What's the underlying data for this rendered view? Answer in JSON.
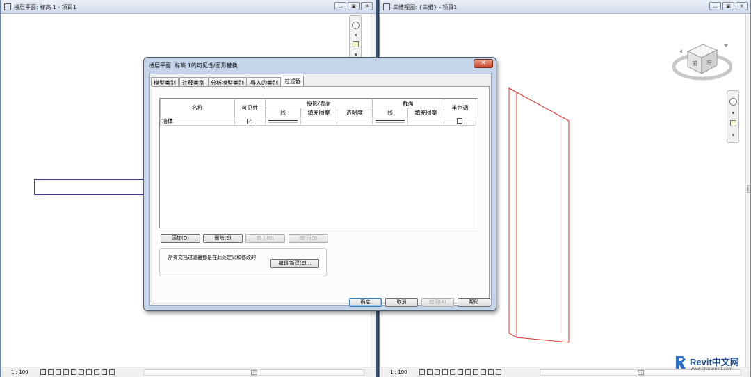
{
  "left_view": {
    "title": "楼层平面: 标高 1 - 项目1",
    "scale": "1 : 100"
  },
  "right_view": {
    "title": "三维视图: {三维} - 项目1",
    "scale": "1 : 100"
  },
  "window_buttons": {
    "minimize": "▭",
    "restore": "▣",
    "close": "✕"
  },
  "dialog": {
    "title": "楼层平面: 标高 1的可见性/图形替换",
    "close_label": "✕",
    "tabs": [
      {
        "label": "模型类别",
        "active": false
      },
      {
        "label": "注释类别",
        "active": false
      },
      {
        "label": "分析模型类别",
        "active": false
      },
      {
        "label": "导入的类别",
        "active": false
      },
      {
        "label": "过滤器",
        "active": true
      }
    ],
    "table": {
      "headers": {
        "name": "名称",
        "visibility": "可见性",
        "projection_group": "投影/表面",
        "projection_line": "线",
        "projection_pattern": "填充图案",
        "projection_transparency": "透明度",
        "cut_group": "截面",
        "cut_line": "线",
        "cut_pattern": "填充图案",
        "halftone": "半色调"
      },
      "rows": [
        {
          "name": "墙体",
          "visible": true,
          "halftone": false
        }
      ]
    },
    "buttons": {
      "add": "添加(D)",
      "delete": "删除(E)",
      "up": "向上(U)",
      "down": "向下(O)",
      "edit_new": "编辑/新建(E)...",
      "ok": "确定",
      "cancel": "取消",
      "apply": "应用(A)",
      "help": "帮助"
    },
    "info_text": "所有文档过滤器都是在此处定义和修改的"
  },
  "viewcube": {
    "front": "前",
    "left": "左"
  },
  "watermark": {
    "title": "Revit中文网",
    "url": "www.chinarevit.com"
  },
  "colors": {
    "dialog_frame": "#c4d5ea",
    "model_line_3d": "#e03030",
    "plan_line": "#3f3f9a"
  }
}
